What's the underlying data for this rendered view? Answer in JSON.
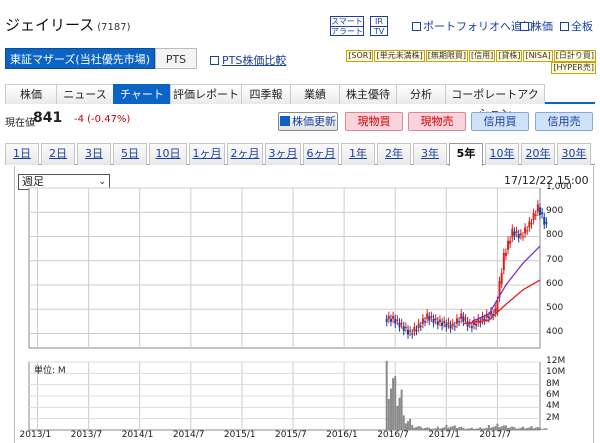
{
  "header": {
    "company_name": "ジェイリース",
    "code": "(7187)",
    "badges": [
      [
        "スマート",
        "アラート"
      ],
      [
        "IR",
        "TV"
      ]
    ],
    "links": [
      "ポートフォリオへ追加",
      "株価",
      "全板"
    ]
  },
  "market": {
    "selected": "東証マザーズ(当社優先市場)",
    "pts": "PTS",
    "pts_compare": "PTS株価比較"
  },
  "tags": {
    "row1": [
      "SOR",
      "単元未満株",
      "無期限買",
      "信用",
      "貸株",
      "NISA",
      "日計り買"
    ],
    "row2": [
      "HYPER売"
    ]
  },
  "nav": [
    "株価",
    "ニュース",
    "チャート",
    "評価レポート",
    "四季報",
    "業績",
    "株主優待",
    "分析",
    "コーポレートアクション"
  ],
  "nav_active": "チャート",
  "quote": {
    "label": "現在値",
    "price": "841",
    "change": "-4 (-0.47%)"
  },
  "actions": {
    "refresh": "株価更新",
    "buttons": [
      "現物買",
      "現物売",
      "信用買",
      "信用売"
    ]
  },
  "periods": [
    "1日",
    "2日",
    "3日",
    "5日",
    "10日",
    "1ヶ月",
    "2ヶ月",
    "3ヶ月",
    "6ヶ月",
    "1年",
    "2年",
    "3年",
    "5年",
    "10年",
    "20年",
    "30年"
  ],
  "period_active": "5年",
  "chart_controls": {
    "interval": "週足",
    "timestamp": "17/12/22 15:00"
  },
  "chart_data": [
    {
      "type": "candlestick",
      "interval": "週足",
      "y_ticks": [
        "1,000",
        "900",
        "800",
        "700",
        "600",
        "500",
        "400"
      ],
      "ylim": [
        340,
        1000
      ],
      "x_labels": [
        "2013/1",
        "2013/7",
        "2014/1",
        "2014/7",
        "2015/1",
        "2015/7",
        "2016/1",
        "2016/7",
        "2017/1",
        "2017/7"
      ],
      "x_range": [
        "2012/12",
        "2017/12"
      ],
      "first_trade": "2016/6",
      "close_series": [
        {
          "d": "2016/06",
          "v": 460
        },
        {
          "d": "2016/07",
          "v": 430
        },
        {
          "d": "2016/08",
          "v": 400
        },
        {
          "d": "2016/09",
          "v": 430
        },
        {
          "d": "2016/10",
          "v": 470
        },
        {
          "d": "2016/11",
          "v": 450
        },
        {
          "d": "2016/12",
          "v": 440
        },
        {
          "d": "2017/01",
          "v": 430
        },
        {
          "d": "2017/02",
          "v": 470
        },
        {
          "d": "2017/03",
          "v": 430
        },
        {
          "d": "2017/04",
          "v": 450
        },
        {
          "d": "2017/05",
          "v": 470
        },
        {
          "d": "2017/06",
          "v": 490
        },
        {
          "d": "2017/07",
          "v": 720
        },
        {
          "d": "2017/08",
          "v": 820
        },
        {
          "d": "2017/09",
          "v": 800
        },
        {
          "d": "2017/10",
          "v": 850
        },
        {
          "d": "2017/11",
          "v": 920
        },
        {
          "d": "2017/12",
          "v": 841
        }
      ],
      "ma_long": [
        {
          "d": "2017/03",
          "v": 440
        },
        {
          "d": "2017/06",
          "v": 455
        },
        {
          "d": "2017/08",
          "v": 520
        },
        {
          "d": "2017/10",
          "v": 580
        },
        {
          "d": "2017/12",
          "v": 620
        }
      ],
      "ma_short": [
        {
          "d": "2017/04",
          "v": 450
        },
        {
          "d": "2017/06",
          "v": 480
        },
        {
          "d": "2017/08",
          "v": 600
        },
        {
          "d": "2017/10",
          "v": 690
        },
        {
          "d": "2017/12",
          "v": 760
        }
      ]
    },
    {
      "type": "bar",
      "title": "単位: M",
      "y_ticks": [
        "12M",
        "10M",
        "8M",
        "6M",
        "4M",
        "2M"
      ],
      "ylim": [
        0,
        12
      ],
      "volumes": [
        {
          "d": "2016/06",
          "v": 12.2
        },
        {
          "d": "2016/07",
          "v": 9.5
        },
        {
          "d": "2016/08",
          "v": 2.6
        },
        {
          "d": "2016/09",
          "v": 0.9
        },
        {
          "d": "2016/10",
          "v": 0.6
        },
        {
          "d": "2016/11",
          "v": 0.4
        },
        {
          "d": "2016/12",
          "v": 0.6
        },
        {
          "d": "2017/01",
          "v": 0.9
        },
        {
          "d": "2017/02",
          "v": 0.8
        },
        {
          "d": "2017/03",
          "v": 0.4
        },
        {
          "d": "2017/04",
          "v": 0.4
        },
        {
          "d": "2017/05",
          "v": 0.5
        },
        {
          "d": "2017/06",
          "v": 0.9
        },
        {
          "d": "2017/07",
          "v": 1.1
        },
        {
          "d": "2017/08",
          "v": 0.8
        },
        {
          "d": "2017/09",
          "v": 0.5
        },
        {
          "d": "2017/10",
          "v": 0.6
        },
        {
          "d": "2017/11",
          "v": 0.7
        },
        {
          "d": "2017/12",
          "v": 0.4
        }
      ]
    }
  ]
}
